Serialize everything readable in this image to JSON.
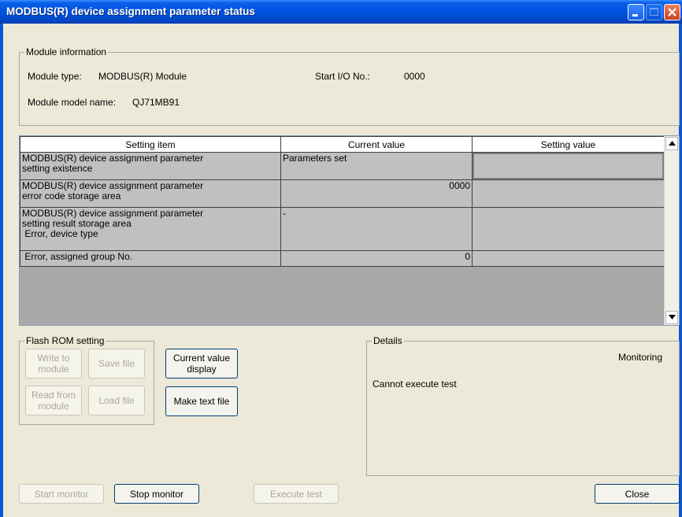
{
  "window": {
    "title": "MODBUS(R) device assignment parameter status"
  },
  "module_info": {
    "group_label": "Module information",
    "type_label": "Module type:",
    "type_value": "MODBUS(R) Module",
    "start_io_label": "Start I/O No.:",
    "start_io_value": "0000",
    "model_label": "Module model name:",
    "model_value": "QJ71MB91"
  },
  "grid": {
    "headers": [
      "Setting item",
      "Current value",
      "Setting value"
    ],
    "rows": [
      {
        "item": [
          "MODBUS(R) device assignment parameter",
          "setting existence"
        ],
        "current": "Parameters set",
        "setting": ""
      },
      {
        "item": [
          "MODBUS(R) device assignment parameter",
          "error code storage area"
        ],
        "current": "0000",
        "setting": ""
      },
      {
        "item": [
          "MODBUS(R) device assignment parameter",
          "setting result storage area",
          " Error, device type"
        ],
        "current": "-",
        "setting": ""
      },
      {
        "item": [
          " Error, assigned group No."
        ],
        "current": "0",
        "setting": ""
      }
    ]
  },
  "flash_rom": {
    "group_label": "Flash ROM setting",
    "write_to_module": "Write to module",
    "save_file": "Save file",
    "read_from_module": "Read from module",
    "load_file": "Load file"
  },
  "actions": {
    "current_value_display": "Current value display",
    "make_text_file": "Make text file"
  },
  "details": {
    "group_label": "Details",
    "status": "Monitoring",
    "message": "Cannot execute test"
  },
  "bottom": {
    "start_monitor": "Start monitor",
    "stop_monitor": "Stop monitor",
    "execute_test": "Execute test",
    "close": "Close"
  },
  "colors": {
    "title_bar": "#0054E3",
    "dialog_bg": "#ECE9D8",
    "grid_cell_bg": "#C0C0C0",
    "grid_empty_bg": "#A8A8A8"
  },
  "icons": {
    "minimize": "minimize-icon",
    "maximize": "maximize-icon",
    "close": "close-icon",
    "scroll_up": "arrow-up-icon",
    "scroll_down": "arrow-down-icon"
  }
}
